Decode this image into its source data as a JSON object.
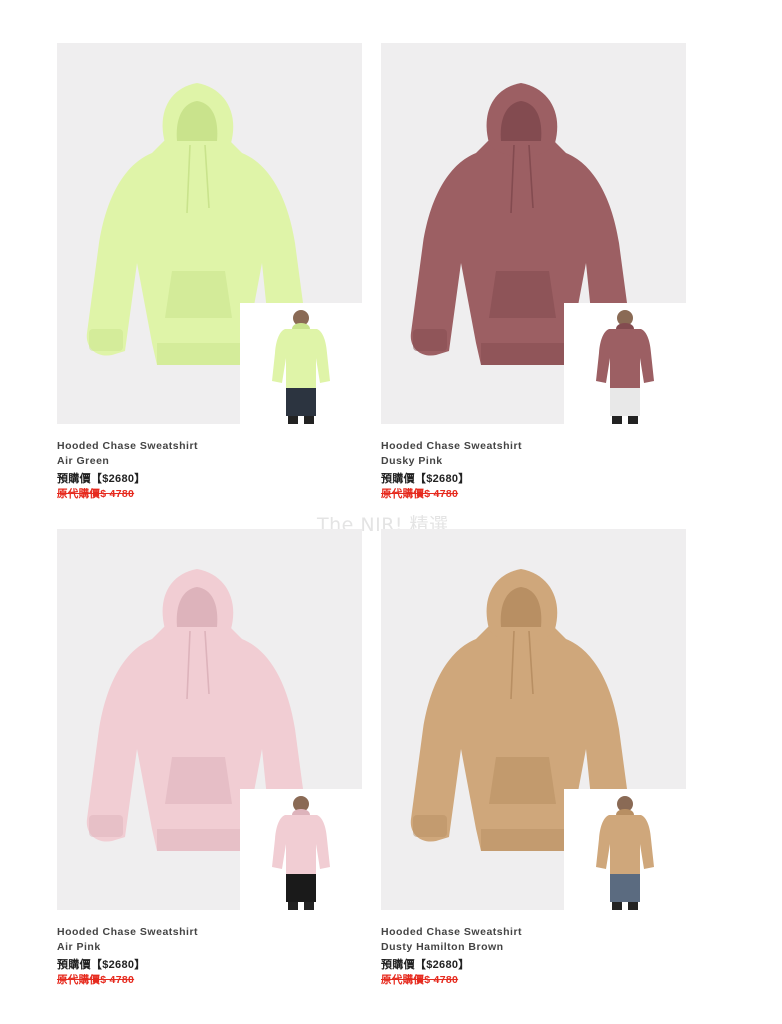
{
  "watermark": "The NIR! 精選",
  "products": [
    {
      "name": "Hooded Chase Sweatshirt",
      "color": "Air Green",
      "price": "預購價【$2680】",
      "original_price": "原代購價$ 4780",
      "swatch": "#dff4a8",
      "shade": "#c9e38c",
      "model_pants": "#2c3440"
    },
    {
      "name": "Hooded Chase Sweatshirt",
      "color": "Dusky Pink",
      "price": "預購價【$2680】",
      "original_price": "原代購價$ 4780",
      "swatch": "#9c5f63",
      "shade": "#834b50",
      "model_pants": "#e8e8e8"
    },
    {
      "name": "Hooded Chase Sweatshirt",
      "color": "Air Pink",
      "price": "預購價【$2680】",
      "original_price": "原代購價$ 4780",
      "swatch": "#f1cdd3",
      "shade": "#ddb3bb",
      "model_pants": "#1a1a1a"
    },
    {
      "name": "Hooded Chase Sweatshirt",
      "color": "Dusty Hamilton Brown",
      "price": "預購價【$2680】",
      "original_price": "原代購價$ 4780",
      "swatch": "#cfa77b",
      "shade": "#b88f63",
      "model_pants": "#5b6b80"
    }
  ]
}
